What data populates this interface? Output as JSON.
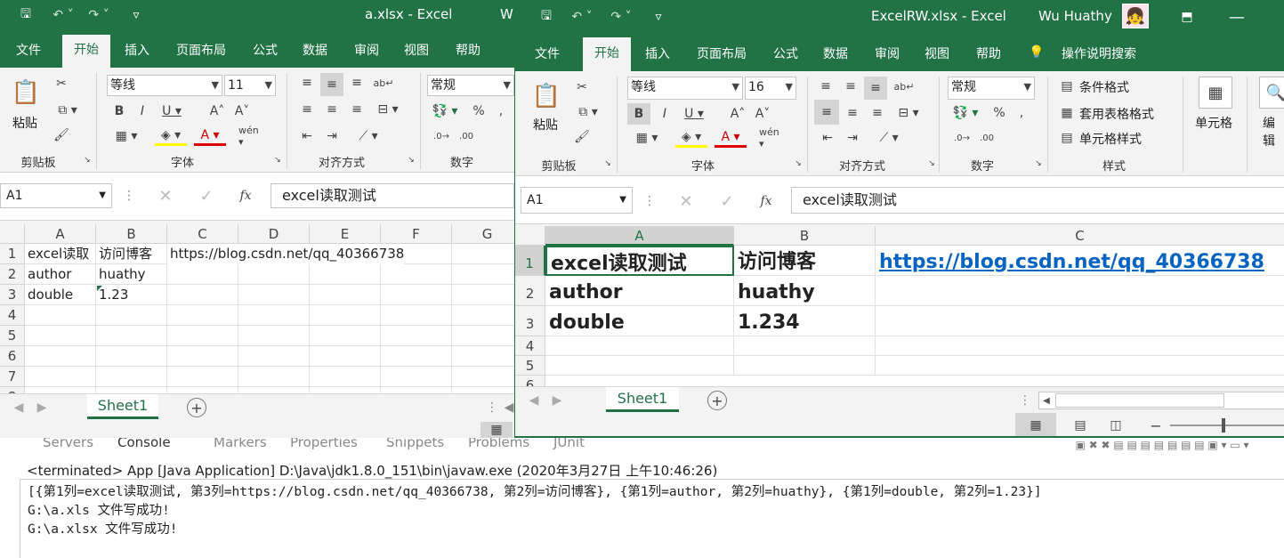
{
  "back_window": {
    "title": "a.xlsx  -  Excel",
    "title_suffix": "W",
    "tabs": [
      "文件",
      "开始",
      "插入",
      "页面布局",
      "公式",
      "数据",
      "审阅",
      "视图",
      "帮助"
    ],
    "active_tab": "开始",
    "font_name": "等线",
    "font_size": "11",
    "number_format": "常规",
    "paste_label": "粘贴",
    "group_labels": [
      "剪贴板",
      "字体",
      "对齐方式",
      "数字"
    ],
    "name_box": "A1",
    "formula": "excel读取测试",
    "columns": [
      "A",
      "B",
      "C",
      "D",
      "E",
      "F",
      "G"
    ],
    "rows": [
      "1",
      "2",
      "3",
      "4",
      "5",
      "6",
      "7",
      "8"
    ],
    "cells": {
      "a1": "excel读取",
      "b1": "访问博客",
      "c1": "https://blog.csdn.net/qq_40366738",
      "a2": "author",
      "b2": "huathy",
      "a3": "double",
      "b3": "1.23"
    },
    "sheet": "Sheet1"
  },
  "front_window": {
    "title": "ExcelRW.xlsx  -  Excel",
    "user": "Wu Huathy",
    "tabs": [
      "文件",
      "开始",
      "插入",
      "页面布局",
      "公式",
      "数据",
      "审阅",
      "视图",
      "帮助"
    ],
    "active_tab": "开始",
    "tell_me": "操作说明搜索",
    "font_name": "等线",
    "font_size": "16",
    "number_format": "常规",
    "paste_label": "粘贴",
    "group_labels": [
      "剪贴板",
      "字体",
      "对齐方式",
      "数字",
      "样式"
    ],
    "styles": [
      "条件格式",
      "套用表格格式",
      "单元格样式"
    ],
    "cells_label": "单元格",
    "edit_label": "编辑",
    "name_box": "A1",
    "formula": "excel读取测试",
    "columns": [
      "A",
      "B",
      "C"
    ],
    "rows": [
      "1",
      "2",
      "3",
      "4",
      "5",
      "6"
    ],
    "cells": {
      "a1": "excel读取测试",
      "b1": "访问博客",
      "c1": "https://blog.csdn.net/qq_40366738",
      "a2": "author",
      "b2": "huathy",
      "a3": "double",
      "b3": "1.234"
    },
    "sheet": "Sheet1",
    "accent": "#217346",
    "link_color": "#0563c1"
  },
  "console": {
    "tabs": [
      "Servers",
      "Console",
      "Markers",
      "Properties",
      "Snippets",
      "Problems",
      "JUnit"
    ],
    "terminated": "<terminated> App [Java Application] D:\\Java\\jdk1.8.0_151\\bin\\javaw.exe (2020年3月27日 上午10:46:26)",
    "lines": [
      "[{第1列=excel读取测试, 第3列=https://blog.csdn.net/qq_40366738, 第2列=访问博客}, {第1列=author, 第2列=huathy}, {第1列=double, 第2列=1.23}]",
      "G:\\a.xls 文件写成功!",
      "G:\\a.xlsx 文件写成功!"
    ]
  }
}
